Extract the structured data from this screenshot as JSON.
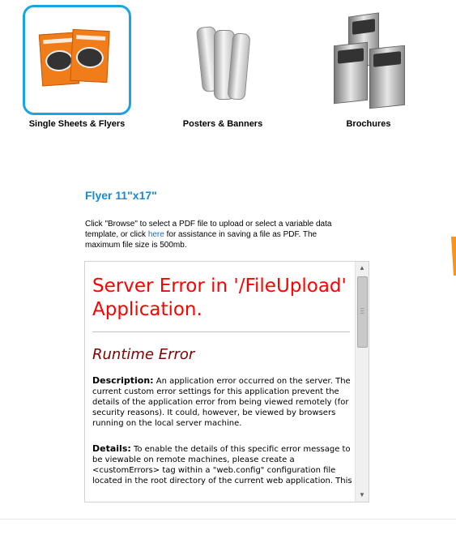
{
  "categories": [
    {
      "label": "Single Sheets & Flyers",
      "icon": "flyer-stack-icon",
      "selected": true
    },
    {
      "label": "Posters & Banners",
      "icon": "poster-rolls-icon",
      "selected": false
    },
    {
      "label": "Brochures",
      "icon": "brochures-icon",
      "selected": false
    }
  ],
  "product": {
    "title": "Flyer 11\"x17\""
  },
  "instructions": {
    "before_link": "Click \"Browse\" to select a PDF file to upload or select a variable data template, or click ",
    "link": "here",
    "after_link": " for assistance in saving a file as PDF. The maximum file size is 500mb."
  },
  "error_page": {
    "title": "Server Error in '/FileUpload' Application.",
    "subtitle": "Runtime Error",
    "description_label": "Description:",
    "description_text": " An application error occurred on the server. The current custom error settings for this application prevent the details of the application error from being viewed remotely (for security reasons). It could, however, be viewed by browsers running on the local server machine.",
    "details_label": "Details:",
    "details_text": " To enable the details of this specific error message to be viewable on remote machines, please create a <customErrors> tag within a \"web.config\" configuration file located in the root directory of the current web application. This"
  },
  "colors": {
    "selected_border": "#19a6e0",
    "heading": "#1a8ad0",
    "error_title": "#ff0000",
    "error_subtitle": "#800000",
    "accent_orange": "#f7941d"
  }
}
